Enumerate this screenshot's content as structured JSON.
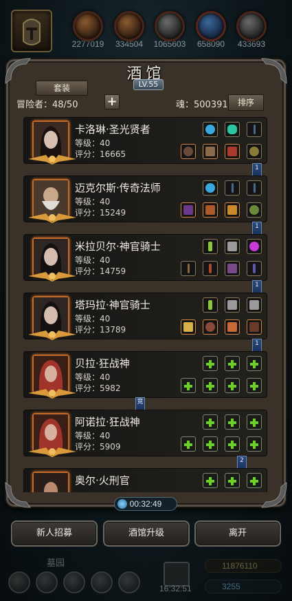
{
  "top": {
    "resources": [
      {
        "value": "2277019",
        "icon": "claw-icon"
      },
      {
        "value": "334504",
        "icon": "scroll-icon"
      },
      {
        "value": "1065603",
        "icon": "helmet-icon"
      },
      {
        "value": "658090",
        "icon": "blue-crystal-icon"
      },
      {
        "value": "433693",
        "icon": "wheel-icon"
      }
    ]
  },
  "panel": {
    "title": "酒馆",
    "level": "LV.55",
    "tab_label": "套装",
    "adventurers_label": "冒险者：48/50",
    "soul_label": "魂：500391",
    "sort_label": "排序"
  },
  "heroes": [
    {
      "name": "卡洛琳·圣光贤者",
      "level": "等级：40",
      "score": "评分：16665",
      "flag": "1"
    },
    {
      "name": "迈克尔斯·传奇法师",
      "level": "等级：40",
      "score": "评分：15249",
      "flag": "1"
    },
    {
      "name": "米拉贝尔·神官骑士",
      "level": "等级：40",
      "score": "评分：14759",
      "flag": "1"
    },
    {
      "name": "塔玛拉·神官骑士",
      "level": "等级：40",
      "score": "评分：13789",
      "flag": "1"
    },
    {
      "name": "贝拉·狂战神",
      "level": "等级：40",
      "score": "评分：5982",
      "flag": "竞"
    },
    {
      "name": "阿诺拉·狂战神",
      "level": "等级：40",
      "score": "评分：5909",
      "flag": "2"
    },
    {
      "name": "奥尔·火刑官",
      "level": "",
      "score": "",
      "flag": ""
    }
  ],
  "timer": "00:32:49",
  "buttons": {
    "recruit": "新人招募",
    "upgrade": "酒馆升级",
    "leave": "离开"
  },
  "bottom": {
    "label": "墓园",
    "gold": "11876110",
    "gems": "3255",
    "clock": "16:32:51"
  },
  "colors": {
    "panel_bg": "#2a241c",
    "green_plus": "#6ccf2a",
    "frame_orange": "#c46a28"
  }
}
